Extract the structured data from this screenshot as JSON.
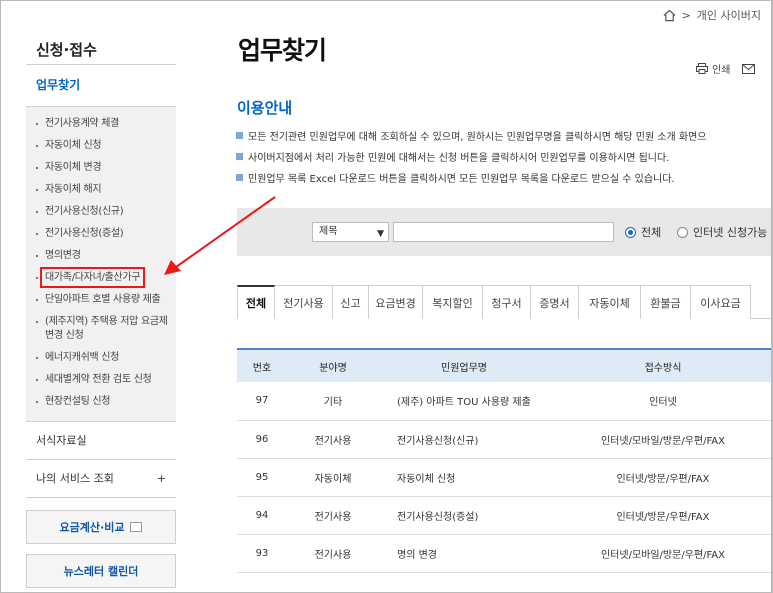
{
  "topnav": {
    "separator": ">",
    "site_label": "개인 사이버지"
  },
  "sidebar": {
    "title": "신청·접수",
    "current": "업무찾기",
    "items": [
      "전기사용계약 체결",
      "자동이체 신청",
      "자동이체 변경",
      "자동이체 해지",
      "전기사용신청(신규)",
      "전기사용신청(증설)",
      "명의변경",
      "대가족/다자녀/출산가구",
      "단일아파트 호별 사용량 제출",
      "(제주지역) 주택용 저압 요금제 변경 신청",
      "에너지캐쉬백 신청",
      "세대별계약 전환 검토 신청",
      "현장컨설팅 신청"
    ],
    "forms": "서식자료실",
    "my_service": "나의 서비스 조회",
    "my_service_toggle": "+",
    "fee_box": "요금계산·비교",
    "news_box": "뉴스레터 캘린더"
  },
  "main": {
    "title": "업무찾기",
    "print_label": "인쇄",
    "guide_title": "이용안내",
    "guide_lines": [
      "모든 전기관련 민원업무에 대해 조회하실 수 있으며, 원하시는 민원업무명을 클릭하시면 해당 민원 소개 화면으",
      "사이버지점에서 처리 가능한 민원에 대해서는 신청 버튼을 클릭하시어 민원업무를 이용하시면 됩니다.",
      "민원업무 목록 Excel 다운로드 버튼을 클릭하시면 모든 민원업무 목록을 다운로드 받으실 수 있습니다."
    ],
    "search": {
      "select_value": "제목",
      "radio_all": "전체",
      "radio_internet": "인터넷 신청가능"
    },
    "tabs": [
      "전체",
      "전기사용",
      "신고",
      "요금변경",
      "복지할인",
      "청구서",
      "증명서",
      "자동이체",
      "환불금",
      "이사요금"
    ],
    "table": {
      "headers": [
        "번호",
        "분야명",
        "민원업무명",
        "접수방식"
      ],
      "rows": [
        [
          "97",
          "기타",
          "(제주) 아파트 TOU 사용량 제출",
          "인터넷"
        ],
        [
          "96",
          "전기사용",
          "전기사용신청(신규)",
          "인터넷/모바일/방문/우편/FAX"
        ],
        [
          "95",
          "자동이체",
          "자동이체 신청",
          "인터넷/방문/우편/FAX"
        ],
        [
          "94",
          "전기사용",
          "전기사용신청(증설)",
          "인터넷/방문/우편/FAX"
        ],
        [
          "93",
          "전기사용",
          "명의 변경",
          "인터넷/모바일/방문/우편/FAX"
        ]
      ]
    }
  },
  "colors": {
    "accent": "#0066c6",
    "highlight": "#e81a1a",
    "table_header": "#dfeaf7"
  }
}
